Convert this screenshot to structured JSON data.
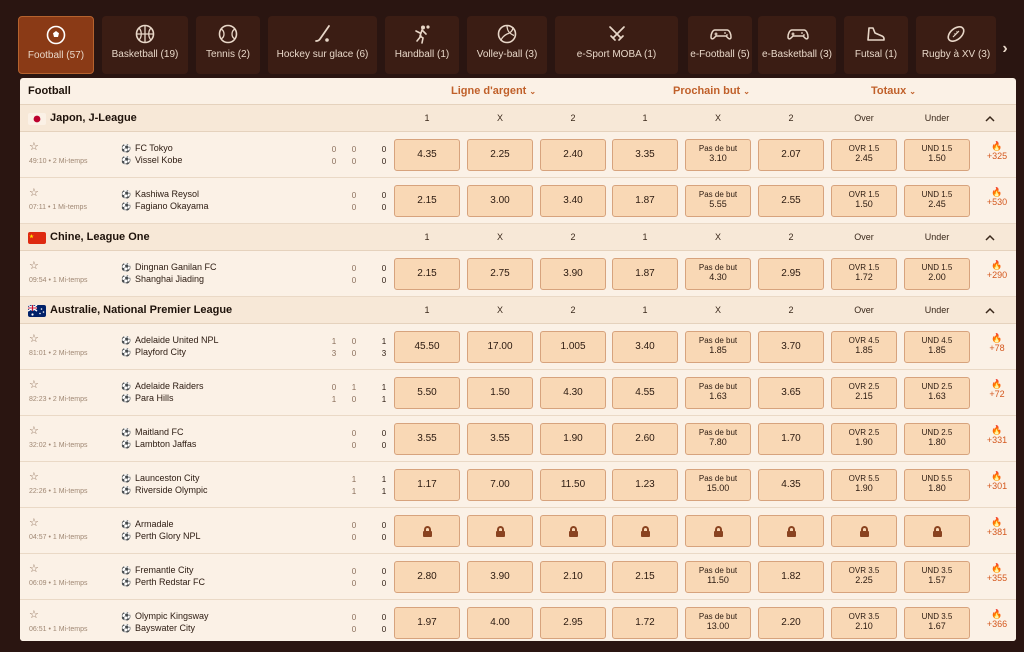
{
  "tabs": [
    {
      "label": "Football (57)",
      "icon": "soccer-ball-icon",
      "active": true
    },
    {
      "label": "Basketball (19)",
      "icon": "basketball-icon"
    },
    {
      "label": "Tennis (2)",
      "icon": "tennis-ball-icon"
    },
    {
      "label": "Hockey sur glace (6)",
      "icon": "hockey-stick-icon"
    },
    {
      "label": "Handball (1)",
      "icon": "handball-player-icon"
    },
    {
      "label": "Volley-ball (3)",
      "icon": "volleyball-icon"
    },
    {
      "label": "e-Sport MOBA (1)",
      "icon": "crossed-swords-icon"
    },
    {
      "label": "e-Football (5)",
      "icon": "gamepad-icon"
    },
    {
      "label": "e-Basketball (3)",
      "icon": "gamepad-icon"
    },
    {
      "label": "Futsal (1)",
      "icon": "shoe-icon"
    },
    {
      "label": "Rugby à XV (3)",
      "icon": "rugby-ball-icon"
    }
  ],
  "panel": {
    "title": "Football",
    "markets": [
      {
        "label": "Ligne d'argent",
        "chevron": "⌄"
      },
      {
        "label": "Prochain but",
        "chevron": "⌄"
      },
      {
        "label": "Totaux",
        "chevron": "⌄"
      }
    ],
    "more_icon": "fire-icon",
    "collapse_icon": "chevron-up-icon"
  },
  "leagues": [
    {
      "name": "Japon, J-League",
      "flag": "japan",
      "cols": [
        "1",
        "X",
        "2",
        "1",
        "X",
        "2",
        "Over",
        "Under"
      ],
      "matches": [
        {
          "time": "49:10 • 2 Mi-temps",
          "home": "FC Tokyo",
          "away": "Vissel Kobe",
          "scores": [
            [
              "0",
              "0",
              "0"
            ],
            [
              "0",
              "0",
              "0"
            ]
          ],
          "odds": [
            {
              "v": "4.35"
            },
            {
              "v": "2.25"
            },
            {
              "v": "2.40"
            },
            {
              "v": "3.35"
            },
            {
              "l1": "Pas de but",
              "l2": "3.10"
            },
            {
              "v": "2.07"
            },
            {
              "l1": "OVR 1.5",
              "l2": "2.45"
            },
            {
              "l1": "UND 1.5",
              "l2": "1.50"
            }
          ],
          "more": "+325"
        },
        {
          "time": "07:11 • 1 Mi-temps",
          "home": "Kashiwa Reysol",
          "away": "Fagiano Okayama",
          "scores": [
            [
              "0",
              "0"
            ],
            [
              "0",
              "0"
            ]
          ],
          "odds": [
            {
              "v": "2.15"
            },
            {
              "v": "3.00"
            },
            {
              "v": "3.40"
            },
            {
              "v": "1.87"
            },
            {
              "l1": "Pas de but",
              "l2": "5.55"
            },
            {
              "v": "2.55"
            },
            {
              "l1": "OVR 1.5",
              "l2": "1.50"
            },
            {
              "l1": "UND 1.5",
              "l2": "2.45"
            }
          ],
          "more": "+530"
        }
      ]
    },
    {
      "name": "Chine, League One",
      "flag": "china",
      "cols": [
        "1",
        "X",
        "2",
        "1",
        "X",
        "2",
        "Over",
        "Under"
      ],
      "matches": [
        {
          "time": "09:54 • 1 Mi-temps",
          "home": "Dingnan Ganilan FC",
          "away": "Shanghai Jiading",
          "scores": [
            [
              "0",
              "0"
            ],
            [
              "0",
              "0"
            ]
          ],
          "odds": [
            {
              "v": "2.15"
            },
            {
              "v": "2.75"
            },
            {
              "v": "3.90"
            },
            {
              "v": "1.87"
            },
            {
              "l1": "Pas de but",
              "l2": "4.30"
            },
            {
              "v": "2.95"
            },
            {
              "l1": "OVR 1.5",
              "l2": "1.72"
            },
            {
              "l1": "UND 1.5",
              "l2": "2.00"
            }
          ],
          "more": "+290"
        }
      ]
    },
    {
      "name": "Australie, National Premier League",
      "flag": "australia",
      "cols": [
        "1",
        "X",
        "2",
        "1",
        "X",
        "2",
        "Over",
        "Under"
      ],
      "matches": [
        {
          "time": "81:01 • 2 Mi-temps",
          "home": "Adelaide United NPL",
          "away": "Playford City",
          "scores": [
            [
              "1",
              "0",
              "1"
            ],
            [
              "3",
              "0",
              "3"
            ]
          ],
          "odds": [
            {
              "v": "45.50"
            },
            {
              "v": "17.00"
            },
            {
              "v": "1.005"
            },
            {
              "v": "3.40"
            },
            {
              "l1": "Pas de but",
              "l2": "1.85"
            },
            {
              "v": "3.70"
            },
            {
              "l1": "OVR 4.5",
              "l2": "1.85"
            },
            {
              "l1": "UND 4.5",
              "l2": "1.85"
            }
          ],
          "more": "+78"
        },
        {
          "time": "82:23 • 2 Mi-temps",
          "home": "Adelaide Raiders",
          "away": "Para Hills",
          "scores": [
            [
              "0",
              "1",
              "1"
            ],
            [
              "1",
              "0",
              "1"
            ]
          ],
          "odds": [
            {
              "v": "5.50"
            },
            {
              "v": "1.50"
            },
            {
              "v": "4.30"
            },
            {
              "v": "4.55"
            },
            {
              "l1": "Pas de but",
              "l2": "1.63"
            },
            {
              "v": "3.65"
            },
            {
              "l1": "OVR 2.5",
              "l2": "2.15"
            },
            {
              "l1": "UND 2.5",
              "l2": "1.63"
            }
          ],
          "more": "+72"
        },
        {
          "time": "32:02 • 1 Mi-temps",
          "home": "Maitland FC",
          "away": "Lambton Jaffas",
          "scores": [
            [
              "0",
              "0"
            ],
            [
              "0",
              "0"
            ]
          ],
          "odds": [
            {
              "v": "3.55"
            },
            {
              "v": "3.55"
            },
            {
              "v": "1.90"
            },
            {
              "v": "2.60"
            },
            {
              "l1": "Pas de but",
              "l2": "7.80"
            },
            {
              "v": "1.70"
            },
            {
              "l1": "OVR 2.5",
              "l2": "1.90"
            },
            {
              "l1": "UND 2.5",
              "l2": "1.80"
            }
          ],
          "more": "+331"
        },
        {
          "time": "22:26 • 1 Mi-temps",
          "home": "Launceston City",
          "away": "Riverside Olympic",
          "scores": [
            [
              "1",
              "1"
            ],
            [
              "1",
              "1"
            ]
          ],
          "odds": [
            {
              "v": "1.17"
            },
            {
              "v": "7.00"
            },
            {
              "v": "11.50"
            },
            {
              "v": "1.23"
            },
            {
              "l1": "Pas de but",
              "l2": "15.00"
            },
            {
              "v": "4.35"
            },
            {
              "l1": "OVR 5.5",
              "l2": "1.90"
            },
            {
              "l1": "UND 5.5",
              "l2": "1.80"
            }
          ],
          "more": "+301"
        },
        {
          "time": "04:57 • 1 Mi-temps",
          "home": "Armadale",
          "away": "Perth Glory NPL",
          "scores": [
            [
              "0",
              "0"
            ],
            [
              "0",
              "0"
            ]
          ],
          "odds": [
            {
              "lock": true
            },
            {
              "lock": true
            },
            {
              "lock": true
            },
            {
              "lock": true
            },
            {
              "lock": true
            },
            {
              "lock": true
            },
            {
              "lock": true
            },
            {
              "lock": true
            }
          ],
          "more": "+381"
        },
        {
          "time": "06:09 • 1 Mi-temps",
          "home": "Fremantle City",
          "away": "Perth Redstar FC",
          "scores": [
            [
              "0",
              "0"
            ],
            [
              "0",
              "0"
            ]
          ],
          "odds": [
            {
              "v": "2.80"
            },
            {
              "v": "3.90"
            },
            {
              "v": "2.10"
            },
            {
              "v": "2.15"
            },
            {
              "l1": "Pas de but",
              "l2": "11.50"
            },
            {
              "v": "1.82"
            },
            {
              "l1": "OVR 3.5",
              "l2": "2.25"
            },
            {
              "l1": "UND 3.5",
              "l2": "1.57"
            }
          ],
          "more": "+355"
        },
        {
          "time": "06:51 • 1 Mi-temps",
          "home": "Olympic Kingsway",
          "away": "Bayswater City",
          "scores": [
            [
              "0",
              "0"
            ],
            [
              "0",
              "0"
            ]
          ],
          "odds": [
            {
              "v": "1.97"
            },
            {
              "v": "4.00"
            },
            {
              "v": "2.95"
            },
            {
              "v": "1.72"
            },
            {
              "l1": "Pas de but",
              "l2": "13.00"
            },
            {
              "v": "2.20"
            },
            {
              "l1": "OVR 3.5",
              "l2": "2.10"
            },
            {
              "l1": "UND 3.5",
              "l2": "1.67"
            }
          ],
          "more": "+366"
        }
      ]
    }
  ]
}
